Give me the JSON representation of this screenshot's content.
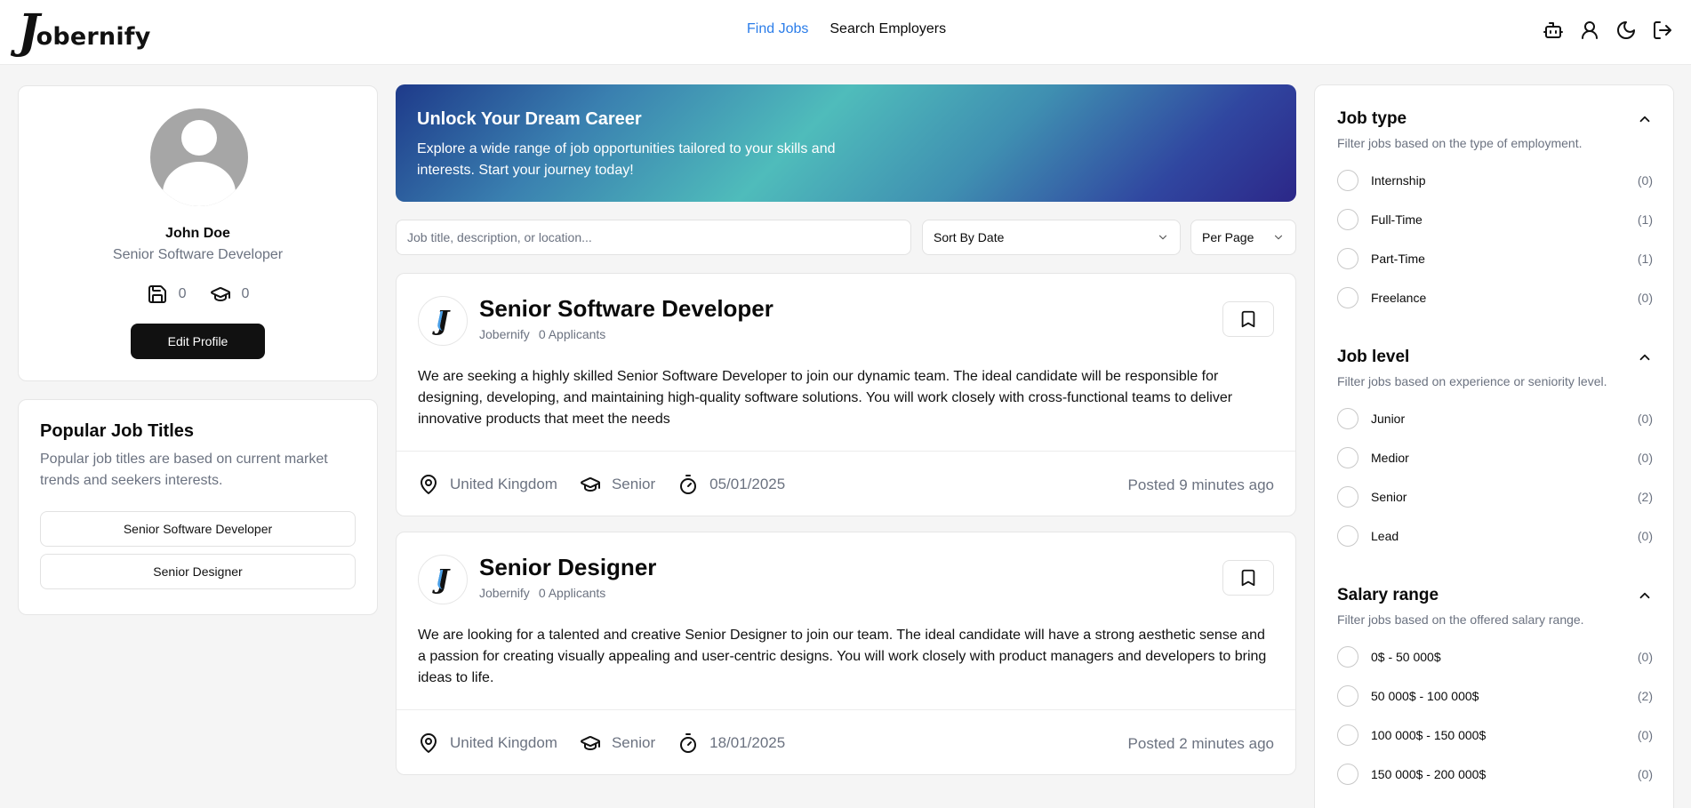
{
  "brand": {
    "logo_letter": "J",
    "logo_text": "obernify"
  },
  "nav": [
    {
      "label": "Find Jobs"
    },
    {
      "label": "Search Employers"
    }
  ],
  "accent_color": "#2b7de9",
  "header_icons": [
    "bot-icon",
    "user-icon",
    "moon-icon",
    "logout-icon"
  ],
  "profile": {
    "name": "John Doe",
    "title": "Senior Software Developer",
    "saved_count": "0",
    "applied_count": "0",
    "edit_label": "Edit Profile"
  },
  "popular": {
    "title": "Popular Job Titles",
    "description": "Popular job titles are based on current market trends and seekers interests.",
    "items": [
      "Senior Software Developer",
      "Senior Designer"
    ]
  },
  "banner": {
    "title": "Unlock Your Dream Career",
    "text": "Explore a wide range of job opportunities tailored to your skills and interests. Start your journey today!"
  },
  "search": {
    "placeholder": "Job title, description, or location...",
    "sort_label": "Sort By Date",
    "per_page_label": "Per Page"
  },
  "jobs": [
    {
      "title": "Senior Software Developer",
      "company": "Jobernify",
      "applicants": "0 Applicants",
      "description": "We are seeking a highly skilled Senior Software Developer to join our dynamic team. The ideal candidate will be responsible for designing, developing, and maintaining high-quality software solutions. You will work closely with cross-functional teams to deliver innovative products that meet the needs",
      "location": "United Kingdom",
      "level": "Senior",
      "deadline": "05/01/2025",
      "posted": "Posted 9 minutes ago"
    },
    {
      "title": "Senior Designer",
      "company": "Jobernify",
      "applicants": "0 Applicants",
      "description": "We are looking for a talented and creative Senior Designer to join our team. The ideal candidate will have a strong aesthetic sense and a passion for creating visually appealing and user-centric designs. You will work closely with product managers and developers to bring ideas to life.",
      "location": "United Kingdom",
      "level": "Senior",
      "deadline": "18/01/2025",
      "posted": "Posted 2 minutes ago"
    }
  ],
  "filters": {
    "job_type": {
      "title": "Job type",
      "description": "Filter jobs based on the type of employment.",
      "options": [
        {
          "label": "Internship",
          "count": "(0)"
        },
        {
          "label": "Full-Time",
          "count": "(1)"
        },
        {
          "label": "Part-Time",
          "count": "(1)"
        },
        {
          "label": "Freelance",
          "count": "(0)"
        }
      ]
    },
    "job_level": {
      "title": "Job level",
      "description": "Filter jobs based on experience or seniority level.",
      "options": [
        {
          "label": "Junior",
          "count": "(0)"
        },
        {
          "label": "Medior",
          "count": "(0)"
        },
        {
          "label": "Senior",
          "count": "(2)"
        },
        {
          "label": "Lead",
          "count": "(0)"
        }
      ]
    },
    "salary": {
      "title": "Salary range",
      "description": "Filter jobs based on the offered salary range.",
      "options": [
        {
          "label": "0$ - 50 000$",
          "count": "(0)"
        },
        {
          "label": "50 000$ - 100 000$",
          "count": "(2)"
        },
        {
          "label": "100 000$ - 150 000$",
          "count": "(0)"
        },
        {
          "label": "150 000$ - 200 000$",
          "count": "(0)"
        }
      ]
    }
  }
}
